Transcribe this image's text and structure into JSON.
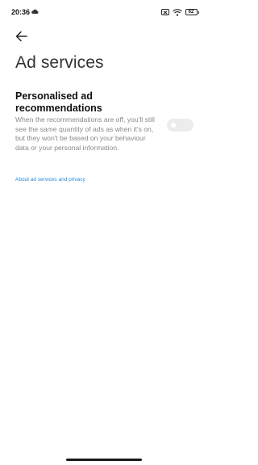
{
  "status_bar": {
    "time": "20:36",
    "battery": "62",
    "icons": [
      "cloud-icon",
      "sim-icon",
      "wifi-icon",
      "battery-icon"
    ]
  },
  "header": {
    "back_icon": "arrow-left-icon",
    "title": "Ad services"
  },
  "setting": {
    "title": "Personalised ad recommendations",
    "description": "When the recommendations are off, you'll still see the same quantity of ads as when it's on, but they won't be based on your behaviour data or your personal information.",
    "enabled": false
  },
  "link": {
    "label": "About ad services and privacy",
    "color": "#2a88d8"
  },
  "colors": {
    "background": "#ffffff",
    "toggle_off": "#ececec",
    "description_text": "#8a8a8a"
  }
}
